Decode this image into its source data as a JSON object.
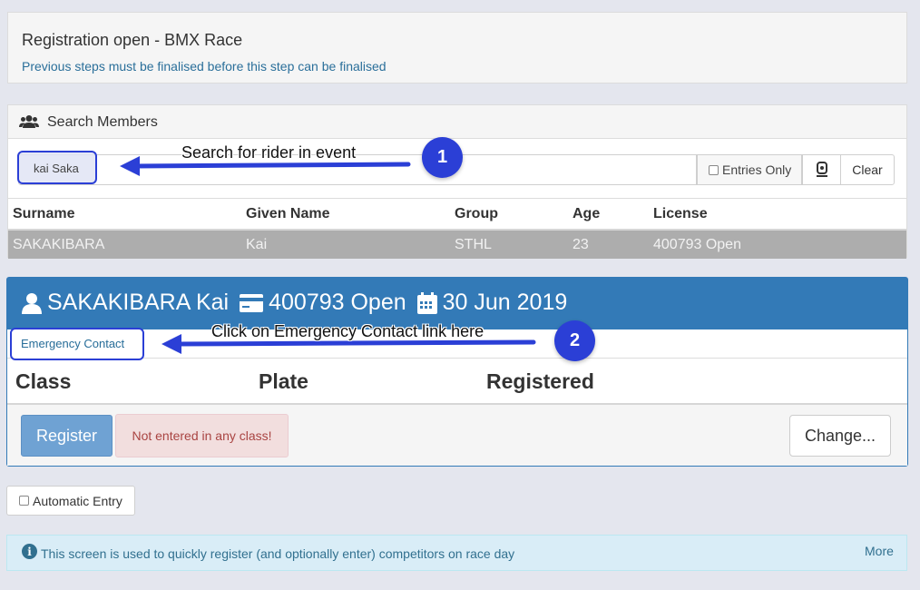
{
  "header": {
    "title": "Registration open - BMX Race",
    "subtitle": "Previous steps must be finalised before this step can be finalised"
  },
  "search": {
    "title": "Search Members",
    "icon": "users-icon",
    "query": "kai Saka",
    "entries_only_label": "Entries Only",
    "scan_icon": "scan-icon",
    "clear_label": "Clear",
    "columns": [
      "Surname",
      "Given Name",
      "Group",
      "Age",
      "License"
    ],
    "rows": [
      [
        "SAKAKIBARA",
        "Kai",
        "STHL",
        "23",
        "400793 Open"
      ]
    ]
  },
  "rider": {
    "name": "SAKAKIBARA Kai",
    "license": "400793 Open",
    "date": "30 Jun 2019",
    "emergency_contact_label": "Emergency Contact",
    "columns": [
      "Class",
      "Plate",
      "Registered"
    ],
    "register_label": "Register",
    "status": "Not entered in any class!",
    "change_label": "Change..."
  },
  "automatic_entry_label": "Automatic Entry",
  "info": {
    "text": "This screen is used to quickly register (and optionally enter) competitors on race day",
    "more_label": "More"
  },
  "annotations": {
    "step1_number": "1",
    "step1_text": "Search for rider in event",
    "step2_number": "2",
    "step2_text": "Click on Emergency Contact link here",
    "color": "#2b3fd6"
  },
  "colors": {
    "primary": "#337ab7",
    "selected_row": "#adadad",
    "danger_bg": "#f2dede",
    "info_bg": "#d9edf7"
  }
}
